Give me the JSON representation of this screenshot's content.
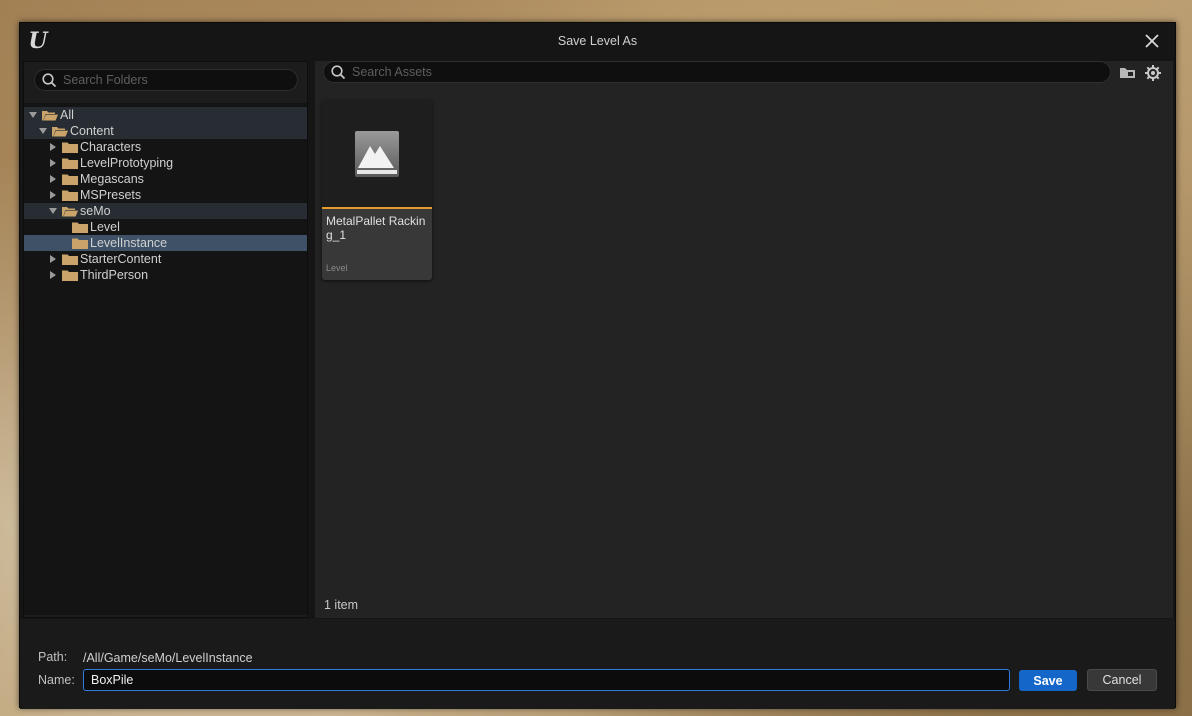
{
  "window": {
    "title": "Save Level As"
  },
  "folders": {
    "search_placeholder": "Search Folders",
    "tree": [
      {
        "label": "All",
        "expanded": true,
        "state": "highlight"
      },
      {
        "label": "Content",
        "expanded": true,
        "state": "highlight"
      },
      {
        "label": "Characters",
        "expanded": false,
        "state": ""
      },
      {
        "label": "LevelPrototyping",
        "expanded": false,
        "state": ""
      },
      {
        "label": "Megascans",
        "expanded": false,
        "state": ""
      },
      {
        "label": "MSPresets",
        "expanded": false,
        "state": ""
      },
      {
        "label": "seMo",
        "expanded": true,
        "state": "highlight"
      },
      {
        "label": "Level",
        "expanded": null,
        "state": ""
      },
      {
        "label": "LevelInstance",
        "expanded": null,
        "state": "selected"
      },
      {
        "label": "StarterContent",
        "expanded": false,
        "state": ""
      },
      {
        "label": "ThirdPerson",
        "expanded": false,
        "state": ""
      }
    ]
  },
  "assets": {
    "search_placeholder": "Search Assets",
    "items": [
      {
        "name": "MetalPallet Racking_1",
        "type": "Level"
      }
    ],
    "count_label": "1 item"
  },
  "footer": {
    "path_label": "Path:",
    "path_value": "/All/Game/seMo/LevelInstance",
    "name_label": "Name:",
    "name_value": "BoxPile",
    "save_label": "Save",
    "cancel_label": "Cancel"
  },
  "colors": {
    "accent": "#1466c9",
    "selection": "#3e5166",
    "folder": "#c9a36a",
    "asset_underline": "#e69b2d"
  }
}
